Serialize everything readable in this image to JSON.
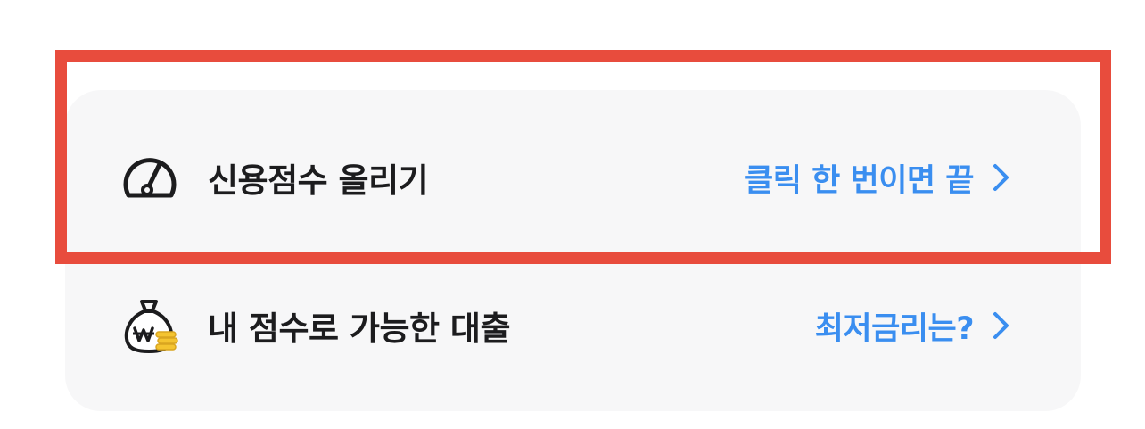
{
  "rows": [
    {
      "icon": "speedometer-gauge-icon",
      "label": "신용점수 올리기",
      "action": "클릭 한 번이면 끝"
    },
    {
      "icon": "money-bag-with-coins-icon",
      "label": "내 점수로 가능한 대출",
      "action": "최저금리는?"
    }
  ],
  "colors": {
    "card_background": "#f7f7f8",
    "label_text": "#1c1c1e",
    "action_text": "#3a8ef0",
    "highlight_border": "#e84c3d",
    "coin": "#f4c430"
  }
}
